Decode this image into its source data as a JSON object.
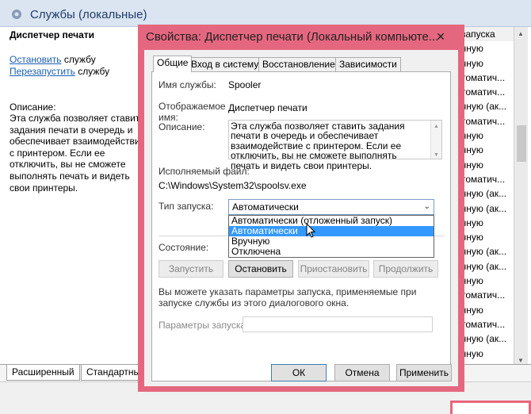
{
  "services_window": {
    "title": "Службы (локальные)",
    "selected_service": "Диспетчер печати",
    "stop_link": "Остановить",
    "stop_suffix": " службу",
    "restart_link": "Перезапустить",
    "restart_suffix": " службу",
    "description_title": "Описание:",
    "description": "Эта служба позволяет ставить задания печати в очередь и обеспечивает взаимодействие с принтером. Если ее отключить, вы не сможете выполнять печать и видеть свои принтеры.",
    "right_column": [
      "запуска",
      "чную",
      "чную",
      "томатич...",
      "томатич...",
      "чную (ак...",
      "томатич...",
      "чную",
      "чную",
      "чную",
      "томатич...",
      "чную (ак...",
      "чную (ак...",
      "чную",
      "чную",
      "чную (ак...",
      "чную (ак...",
      "чную",
      "томатич...",
      "чную",
      "томатич...",
      "чную (ак...",
      "чную"
    ],
    "tabs": [
      "Расширенный",
      "Стандартный"
    ]
  },
  "dialog": {
    "title": "Свойства: Диспетчер печати (Локальный компьюте...",
    "close_glyph": "✕",
    "tabs": [
      "Общие",
      "Вход в систему",
      "Восстановление",
      "Зависимости"
    ],
    "service_name_label": "Имя службы:",
    "service_name": "Spooler",
    "display_name_label": "Отображаемое\nимя:",
    "display_name": "Диспетчер печати",
    "description_label": "Описание:",
    "description": "Эта служба позволяет ставить задания печати в очередь и обеспечивает взаимодействие с принтером. Если ее отключить, вы не сможете выполнять печать и видеть свои принтеры.",
    "exe_label": "Исполняемый файл:",
    "exe_path": "C:\\Windows\\System32\\spoolsv.exe",
    "startup_type_label": "Тип запуска:",
    "startup_type_value": "Автоматически",
    "startup_options": [
      "Автоматически (отложенный запуск)",
      "Автоматически",
      "Вручную",
      "Отключена"
    ],
    "startup_selected_index": 1,
    "status_label": "Состояние:",
    "buttons": {
      "start": "Запустить",
      "stop": "Остановить",
      "pause": "Приостановить",
      "resume": "Продолжить"
    },
    "hint": "Вы можете указать параметры запуска, применяемые при запуске службы из этого диалогового окна.",
    "params_label": "Параметры запуска:",
    "params_value": "",
    "ok": "ОК",
    "cancel": "Отмена",
    "apply": "Применить"
  },
  "colors": {
    "highlight_frame": "#e5677f",
    "selection": "#3399ff",
    "link": "#1a5fb4"
  }
}
